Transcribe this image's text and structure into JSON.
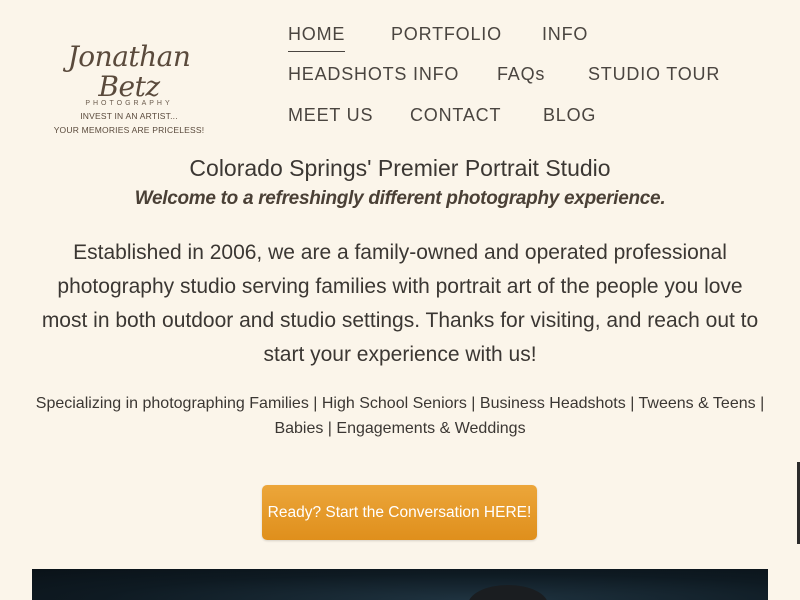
{
  "logo": {
    "script_text": "Jonathan Betz",
    "sub_text": "PHOTOGRAPHY",
    "tagline_1": "INVEST IN AN ARTIST...",
    "tagline_2": "YOUR MEMORIES ARE PRICELESS!"
  },
  "nav": {
    "items": [
      {
        "label": "HOME"
      },
      {
        "label": "PORTFOLIO"
      },
      {
        "label": "INFO"
      },
      {
        "label": "HEADSHOTS INFO"
      },
      {
        "label": "FAQs"
      },
      {
        "label": "STUDIO TOUR"
      },
      {
        "label": "MEET US"
      },
      {
        "label": "CONTACT"
      },
      {
        "label": "BLOG"
      }
    ]
  },
  "main": {
    "title": "Colorado Springs' Premier Portrait Studio",
    "subtitle": "Welcome to a refreshingly different photography experience.",
    "intro": "Established in 2006, we are a family-owned and operated professional photography studio serving families with portrait art of the people you love most in both outdoor and studio settings. Thanks for visiting, and reach out to start your experience with us!",
    "specializing": "Specializing in photographing Families | High School Seniors | Business Headshots | Tweens & Teens | Babies | Engagements & Weddings",
    "cta_label": "Ready? Start the Conversation HERE!"
  },
  "colors": {
    "background": "#fbf5ea",
    "accent": "#e69a2a",
    "text": "#3b3733"
  }
}
